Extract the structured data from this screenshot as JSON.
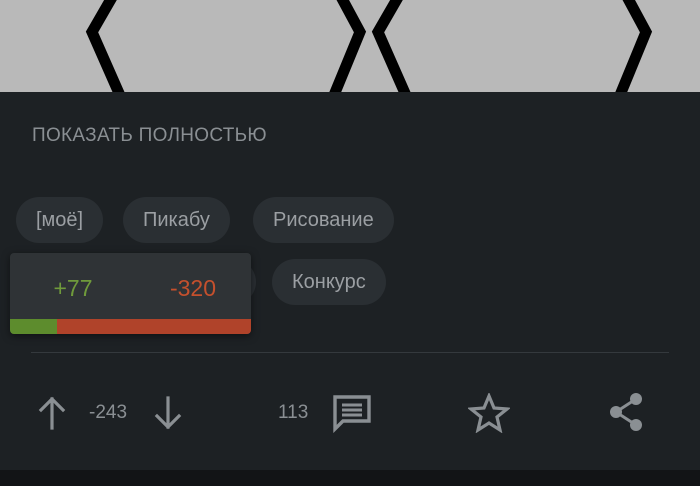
{
  "post": {
    "show_more_label": "ПОКАЗАТЬ ПОЛНОСТЬЮ",
    "tags": [
      "[моё]",
      "Пикабу",
      "Рисование",
      "Конкурс"
    ]
  },
  "rating_popup": {
    "pluses": "+77",
    "minuses": "-320",
    "plus_fraction": 0.194
  },
  "actions": {
    "rating": "-243",
    "comments_count": "113",
    "icons": [
      "arrow-up-icon",
      "arrow-down-icon",
      "comment-icon",
      "star-icon",
      "share-icon"
    ]
  },
  "colors": {
    "background": "#1d2124",
    "tag_background": "#2a2f33",
    "plus_green": "#5d8c2d",
    "minus_red": "#b0432a"
  }
}
